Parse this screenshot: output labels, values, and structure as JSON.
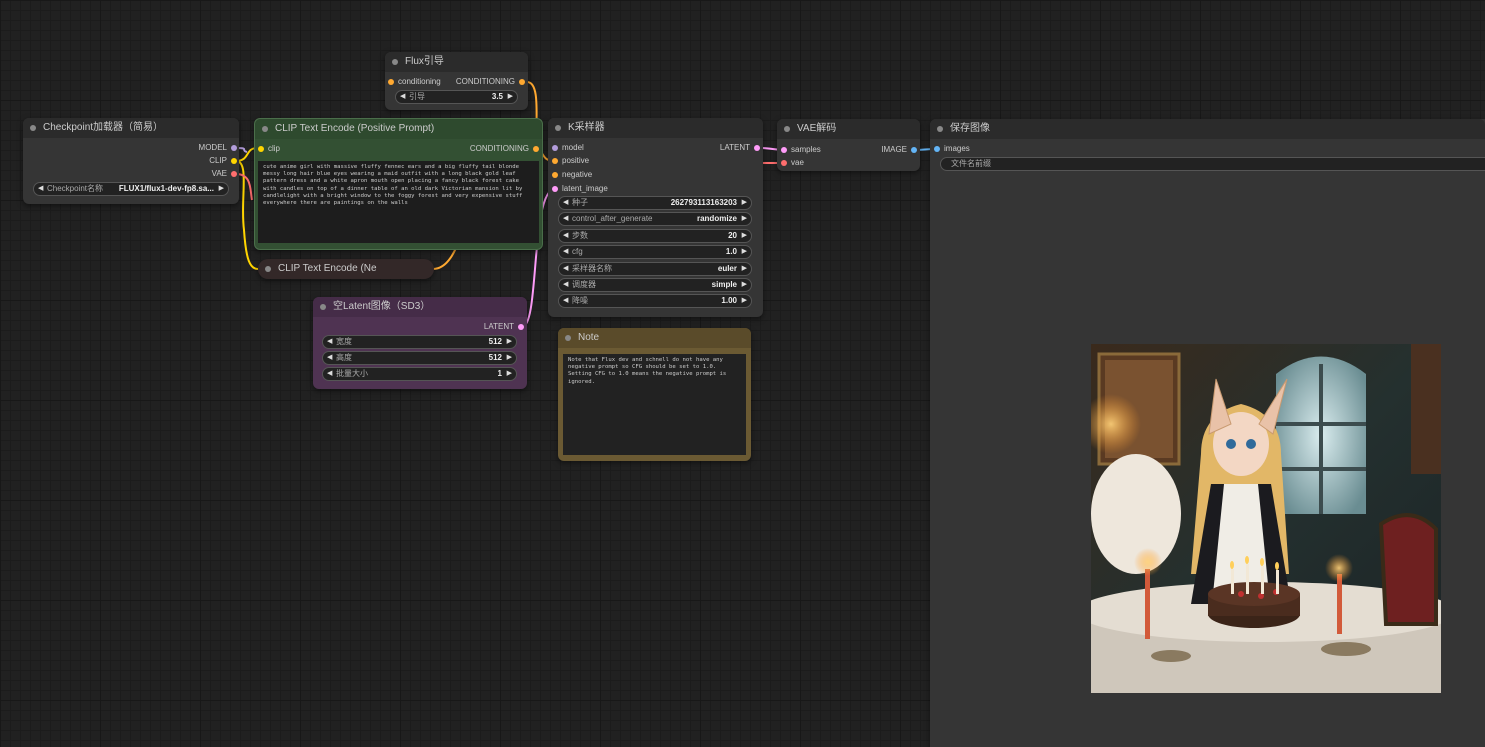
{
  "nodes": {
    "flux_guidance": {
      "title": "Flux引导",
      "input_label": "conditioning",
      "output_label": "CONDITIONING",
      "widget_label": "引导",
      "widget_value": "3.5"
    },
    "checkpoint": {
      "title": "Checkpoint加载器（简易）",
      "outputs": [
        "MODEL",
        "CLIP",
        "VAE"
      ],
      "widget_label": "Checkpoint名称",
      "widget_value": "FLUX1/flux1-dev-fp8.sa..."
    },
    "clip_positive": {
      "title": "CLIP Text Encode (Positive Prompt)",
      "input_label": "clip",
      "output_label": "CONDITIONING",
      "text": "cute anime girl with massive fluffy fennec ears and a big fluffy tail blonde messy long hair blue eyes wearing a maid outfit with a long black gold leaf pattern dress and a white apron mouth open placing a fancy black forest cake with candles on top of a dinner table of an old dark Victorian mansion lit by candlelight with a bright window to the foggy forest and very expensive stuff everywhere there are paintings on the walls"
    },
    "clip_negative": {
      "title": "CLIP Text Encode (Ne"
    },
    "ksampler": {
      "title": "K采样器",
      "inputs": [
        "model",
        "positive",
        "negative",
        "latent_image"
      ],
      "output_label": "LATENT",
      "widgets": [
        {
          "label": "种子",
          "value": "262793113163203"
        },
        {
          "label": "control_after_generate",
          "value": "randomize"
        },
        {
          "label": "步数",
          "value": "20"
        },
        {
          "label": "cfg",
          "value": "1.0"
        },
        {
          "label": "采样器名称",
          "value": "euler"
        },
        {
          "label": "调度器",
          "value": "simple"
        },
        {
          "label": "降噪",
          "value": "1.00"
        }
      ]
    },
    "vae_decode": {
      "title": "VAE解码",
      "inputs": [
        "samples",
        "vae"
      ],
      "output_label": "IMAGE"
    },
    "save_image": {
      "title": "保存图像",
      "input_label": "images",
      "widget_label": "文件名前缀"
    },
    "empty_latent": {
      "title": "空Latent图像（SD3）",
      "output_label": "LATENT",
      "widgets": [
        {
          "label": "宽度",
          "value": "512"
        },
        {
          "label": "高度",
          "value": "512"
        },
        {
          "label": "批量大小",
          "value": "1"
        }
      ]
    },
    "note": {
      "title": "Note",
      "text": "Note that Flux dev and schnell do not have any negative prompt so CFG should be set to 1.0. Setting CFG to 1.0 means the negative prompt is ignored."
    }
  },
  "colors": {
    "model": "#b39ddb",
    "clip": "#ffd500",
    "vae": "#ff6e6e",
    "conditioning": "#ffa931",
    "latent": "#ff9cf9",
    "image": "#64b5f6",
    "green_node": "#2e4a2e",
    "purple_node": "#4a2f4f",
    "note_node": "#6b5a33"
  },
  "icons": {
    "left_arrow": "left-triangle-icon",
    "right_arrow": "right-triangle-icon"
  },
  "preview": {
    "description_icon": "generated-image-preview"
  }
}
